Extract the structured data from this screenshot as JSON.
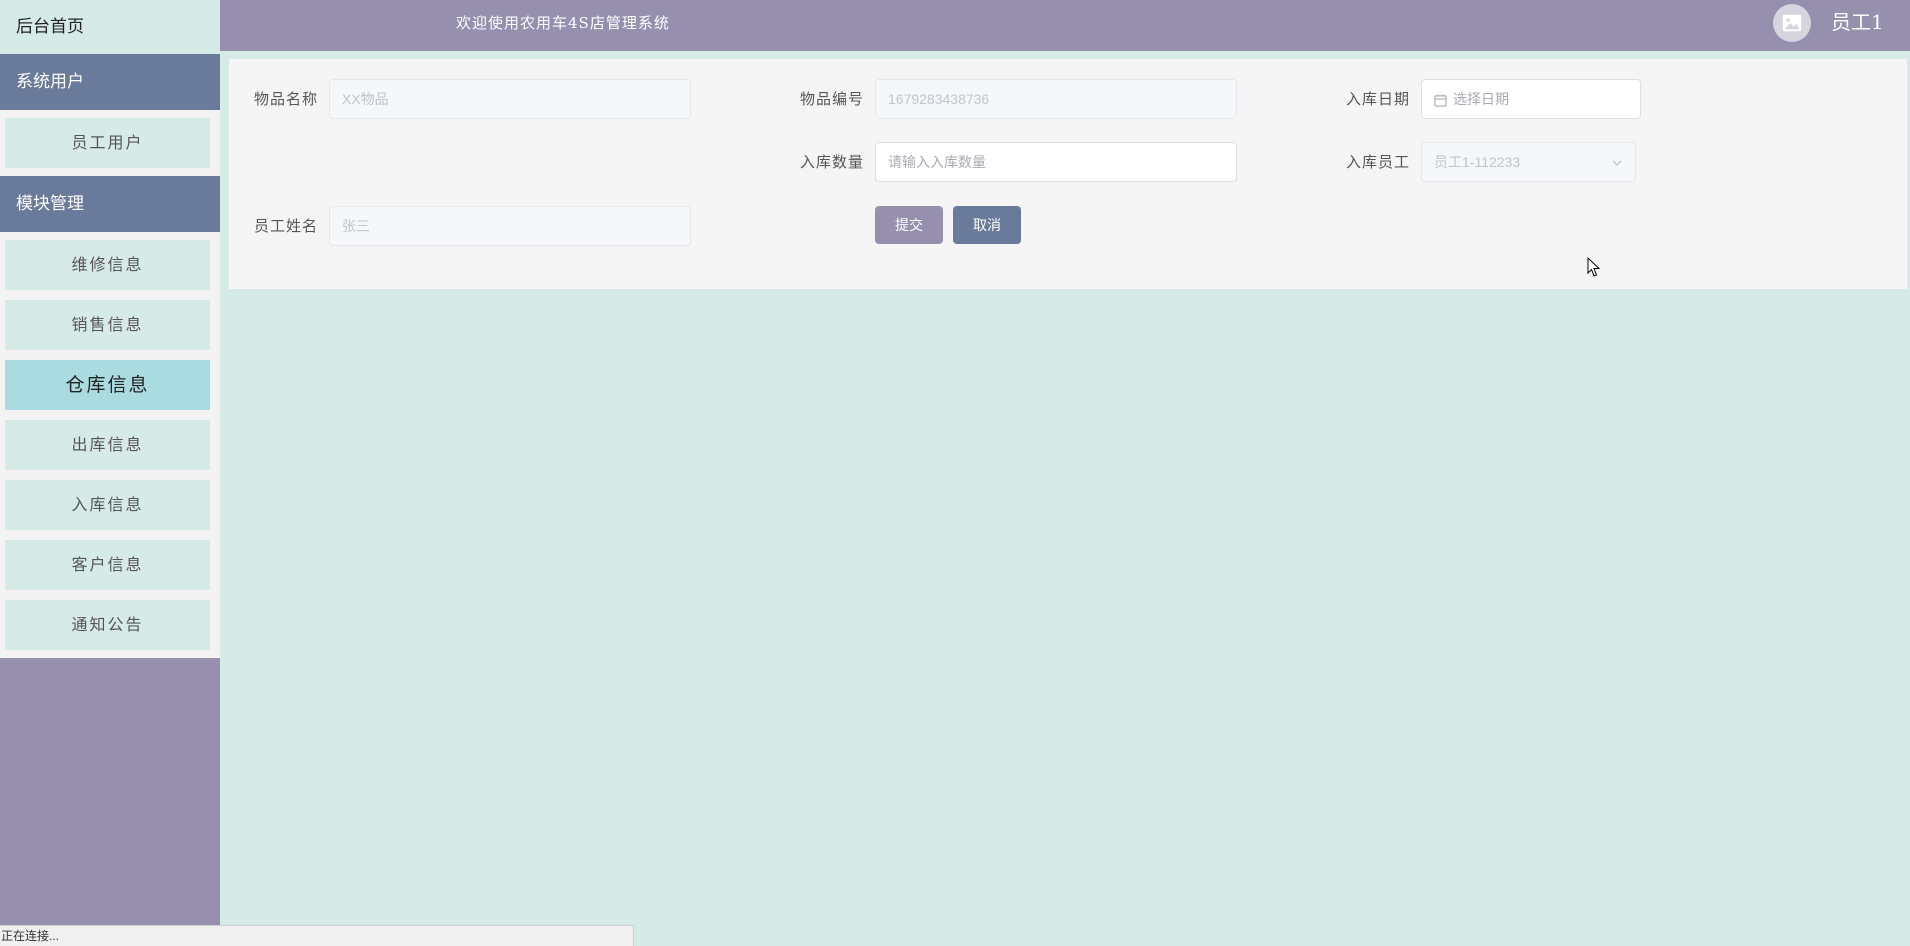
{
  "sidebar": {
    "home_label": "后台首页",
    "groups": [
      {
        "label": "系统用户",
        "items": [
          {
            "label": "员工用户"
          }
        ]
      },
      {
        "label": "模块管理",
        "items": [
          {
            "label": "维修信息"
          },
          {
            "label": "销售信息"
          },
          {
            "label": "仓库信息",
            "active": true
          },
          {
            "label": "出库信息"
          },
          {
            "label": "入库信息"
          },
          {
            "label": "客户信息"
          },
          {
            "label": "通知公告"
          }
        ]
      }
    ]
  },
  "header": {
    "title": "欢迎使用农用车4S店管理系统",
    "user_name": "员工1",
    "avatar_icon": "image-icon"
  },
  "form": {
    "item_name": {
      "label": "物品名称",
      "value": "XX物品"
    },
    "item_code": {
      "label": "物品编号",
      "value": "1679283438736"
    },
    "inbound_date": {
      "label": "入库日期",
      "placeholder": "选择日期",
      "icon": "calendar-icon"
    },
    "inbound_qty": {
      "label": "入库数量",
      "placeholder": "请输入入库数量"
    },
    "inbound_staff": {
      "label": "入库员工",
      "value": "员工1-112233",
      "icon": "chevron-down-icon"
    },
    "staff_name": {
      "label": "员工姓名",
      "value": "张三"
    },
    "submit_label": "提交",
    "cancel_label": "取消"
  },
  "statusbar": {
    "text": "正在连接..."
  },
  "colors": {
    "accent_purple": "#9690ae",
    "accent_slate": "#6a7a9b",
    "background_mint": "#d6eae8",
    "active_item": "#a9dbe0"
  }
}
